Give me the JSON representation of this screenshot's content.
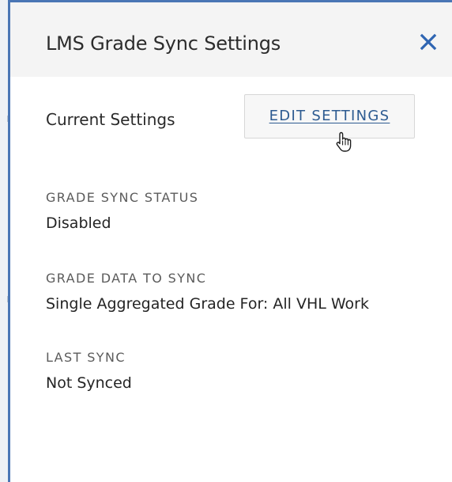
{
  "modal": {
    "title": "LMS Grade Sync Settings",
    "close_icon": "close-icon"
  },
  "current_settings": {
    "label": "Current Settings",
    "edit_button_label": "EDIT SETTINGS"
  },
  "settings": {
    "grade_sync_status": {
      "label": "GRADE SYNC STATUS",
      "value": "Disabled"
    },
    "grade_data_to_sync": {
      "label": "GRADE DATA TO SYNC",
      "value": "Single Aggregated Grade For: All VHL Work"
    },
    "last_sync": {
      "label": "LAST SYNC",
      "value": "Not Synced"
    }
  },
  "cursor": {
    "icon": "hand-pointer-cursor-icon"
  },
  "colors": {
    "accent": "#4a76b5",
    "link": "#2d5b91",
    "header_bg": "#f4f4f4",
    "text": "#2c2c2c",
    "label": "#5b5b5b"
  }
}
